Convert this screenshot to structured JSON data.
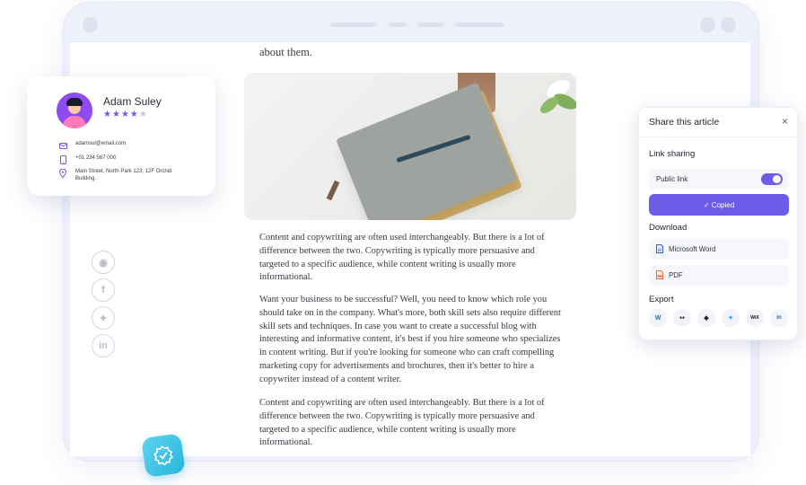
{
  "colors": {
    "accent": "#6c5ce7",
    "badge": "#27b6dc"
  },
  "article": {
    "intro_tail": "about them.",
    "paragraphs": [
      "Content and copywriting are often used interchangeably. But there is a lot of difference between the two. Copywriting is typically more persuasive and targeted to a specific audience, while content writing is usually more informational.",
      "Want your business to be successful? Well, you need to know which role you should take on in the company. What's more, both skill sets also require different skill sets and techniques. In case you want to create a successful blog with interesting and informative content, it's best if you hire someone who specializes in content writing. But if you're looking for someone who can craft compelling marketing copy for advertisements and brochures, then it's better to hire a copywriter instead of a content writer.",
      "Content and copywriting are often used interchangeably. But there is a lot of difference between the two. Copywriting is typically more persuasive and targeted to a specific audience, while content writing is usually more informational."
    ]
  },
  "social": [
    {
      "icon": "reddit-icon",
      "glyph": "◉"
    },
    {
      "icon": "facebook-icon",
      "glyph": "f"
    },
    {
      "icon": "twitter-icon",
      "glyph": "✦"
    },
    {
      "icon": "linkedin-icon",
      "glyph": "in"
    }
  ],
  "profile": {
    "name": "Adam Suley",
    "rating": 4,
    "rating_max": 5,
    "email": "adamsul@email.com",
    "phone": "+01 234 567 000",
    "address": "Main Street, North Park 123, 12F Orchid Building."
  },
  "share": {
    "title": "Share this article",
    "close": "×",
    "link_section": "Link sharing",
    "public_link_label": "Public link",
    "public_link_on": true,
    "copied_label": "✓ Copied",
    "download_section": "Download",
    "download_items": [
      "Microsoft Word",
      "PDF"
    ],
    "export_section": "Export",
    "export_targets": [
      {
        "icon": "wordpress-icon",
        "glyph": "W",
        "color": "#21759b"
      },
      {
        "icon": "medium-icon",
        "glyph": "●●",
        "color": "#111111"
      },
      {
        "icon": "ghost-icon",
        "glyph": "◆",
        "color": "#2b2b2b"
      },
      {
        "icon": "twitter-icon",
        "glyph": "✦",
        "color": "#1da1f2"
      },
      {
        "icon": "wix-icon",
        "glyph": "WiX",
        "color": "#111111"
      },
      {
        "icon": "linkedin-icon",
        "glyph": "in",
        "color": "#0a66c2"
      }
    ]
  }
}
